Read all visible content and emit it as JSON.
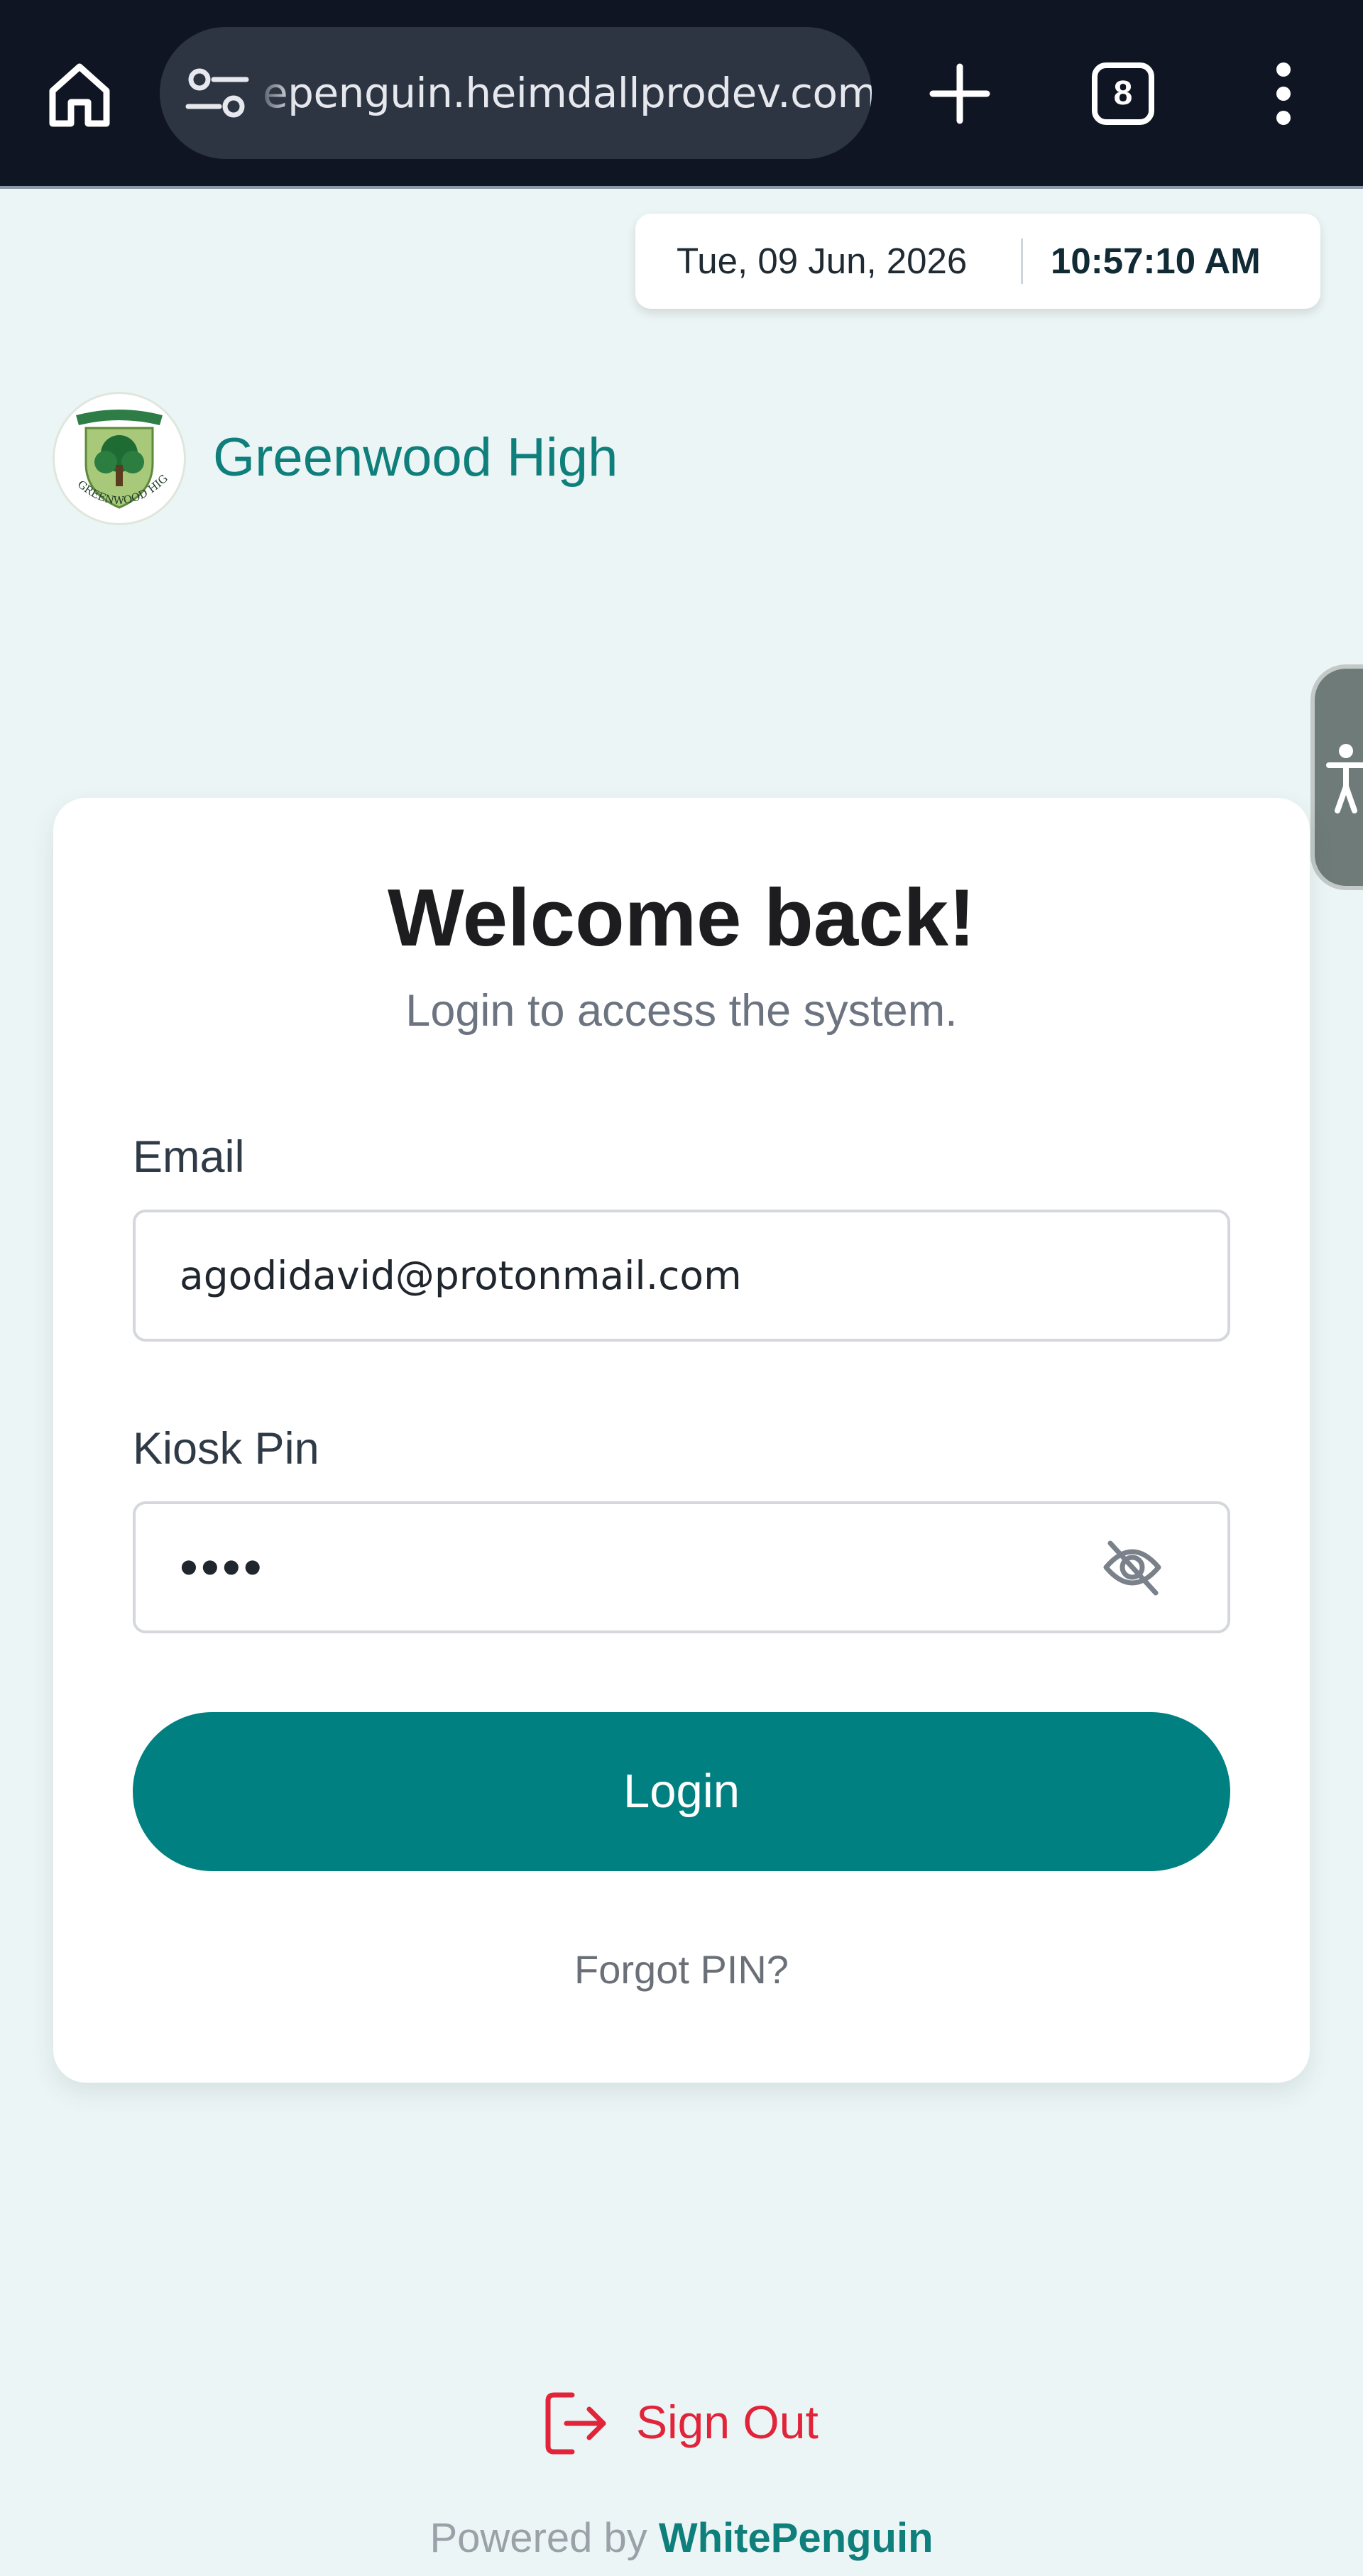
{
  "browser": {
    "url": "epenguin.heimdallprodev.com",
    "tab_count": "8",
    "icons": [
      "home-icon",
      "tune-icon",
      "plus-icon",
      "tabs-icon",
      "more-vert-icon"
    ]
  },
  "header": {
    "date": "Tue, 09 Jun, 2026",
    "time": "10:57:10 AM",
    "school_name": "Greenwood High",
    "logo_text": "GREENWOOD HIGH"
  },
  "login_card": {
    "title": "Welcome back!",
    "subtitle": "Login to access the system.",
    "email_label": "Email",
    "email_value": "agodidavid@protonmail.com",
    "pin_label": "Kiosk Pin",
    "pin_value": "••••",
    "login_button": "Login",
    "forgot_link": "Forgot PIN?"
  },
  "footer": {
    "sign_out": "Sign Out",
    "powered_prefix": "Powered by",
    "powered_brand": "WhitePenguin"
  },
  "colors": {
    "primary": "#008080",
    "background": "#ecf5f5",
    "danger": "#e1243a",
    "browser_bar": "#0f1522"
  }
}
